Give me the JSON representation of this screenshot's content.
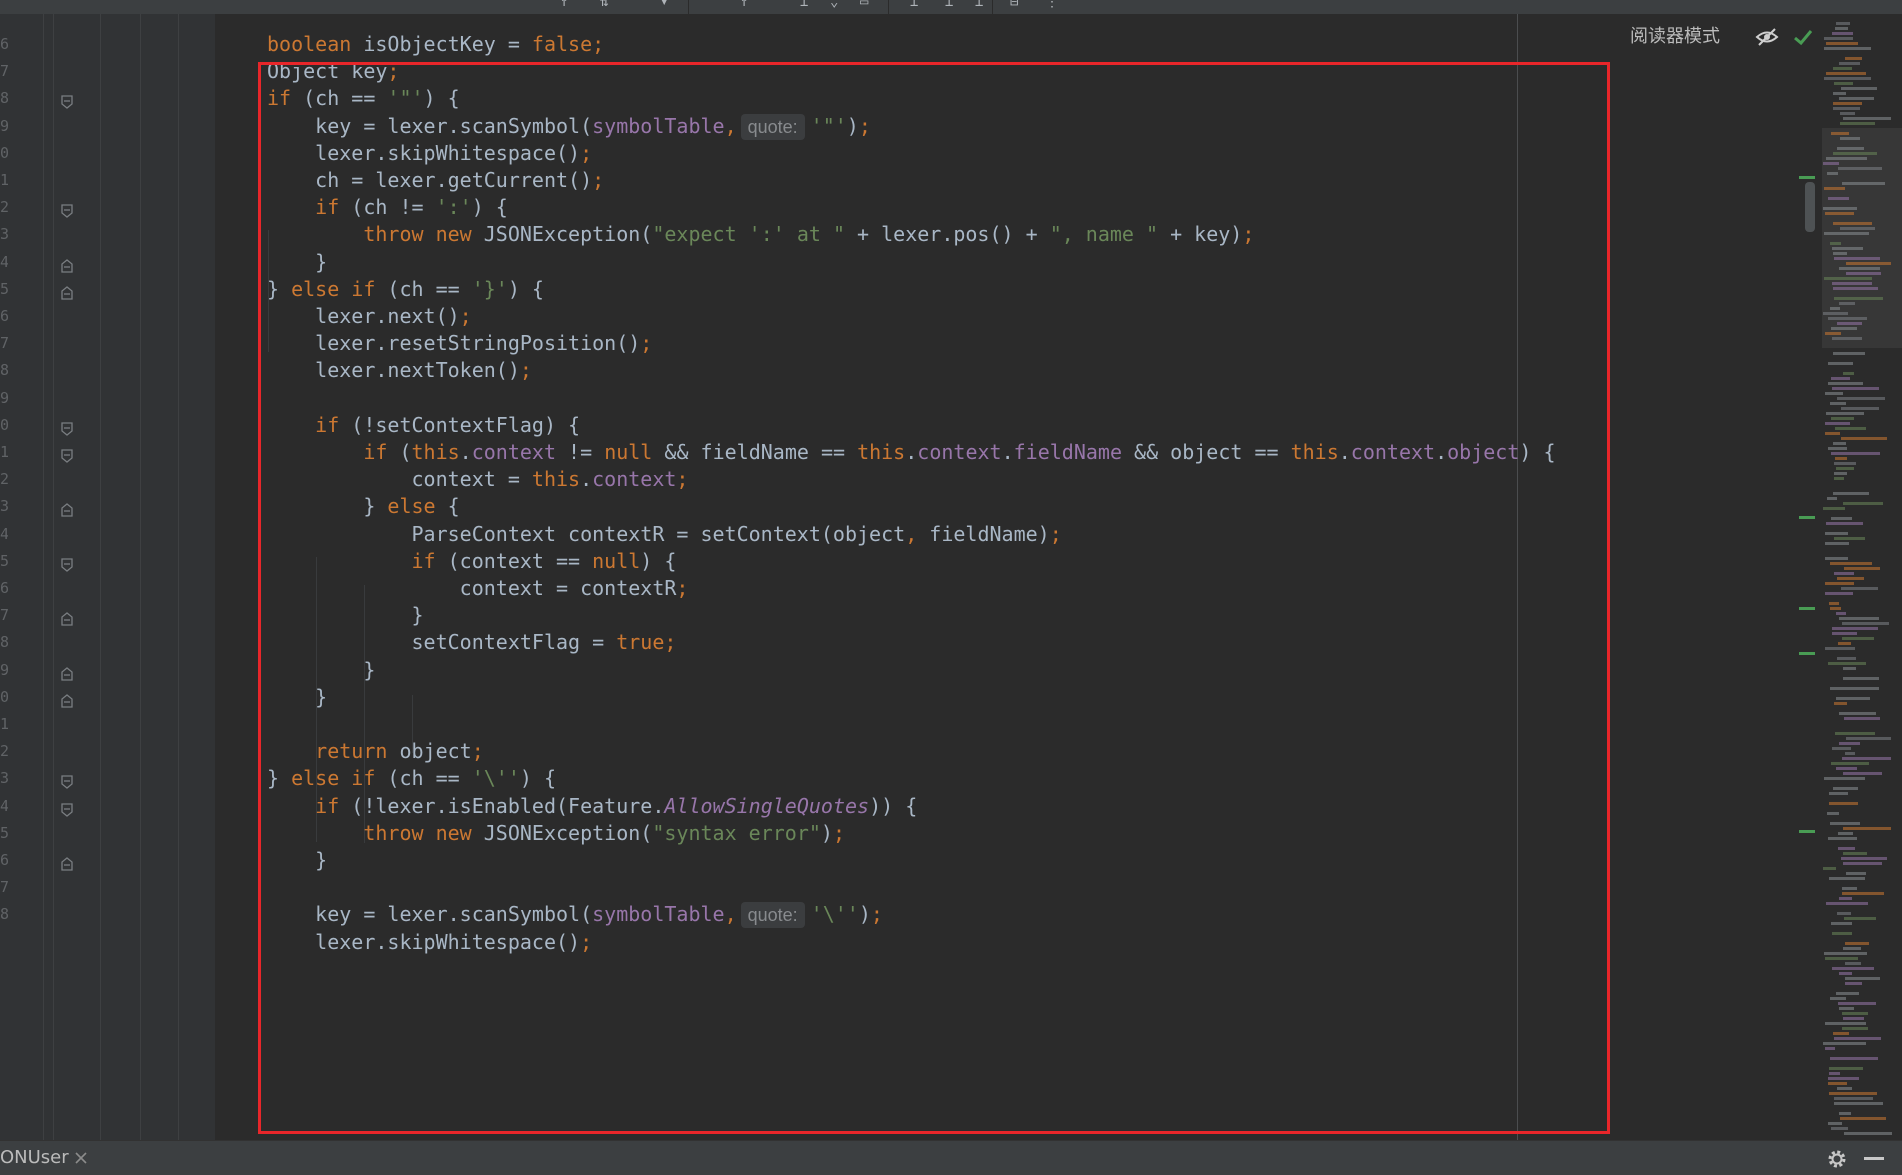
{
  "editor": {
    "reader_mode_label": "阅读器模式",
    "line_numbers": [
      "6",
      "7",
      "8",
      "9",
      "0",
      "1",
      "2",
      "3",
      "4",
      "5",
      "6",
      "7",
      "8",
      "9",
      "0",
      "1",
      "2",
      "3",
      "4",
      "5",
      "6",
      "7",
      "8",
      "9",
      "0",
      "1",
      "2",
      "3",
      "4",
      "5",
      "6",
      "7",
      "8"
    ],
    "code_lines": [
      [
        [
          "boolean ",
          "kw"
        ],
        [
          "isObjectKey = ",
          ""
        ],
        [
          "false",
          "kw"
        ],
        [
          ";",
          "kw"
        ]
      ],
      [
        [
          "Object key",
          ""
        ],
        [
          ";",
          "kw"
        ]
      ],
      [
        [
          "if ",
          "kw"
        ],
        [
          "(ch == ",
          ""
        ],
        [
          "'\"'",
          "str"
        ],
        [
          ") {",
          ""
        ]
      ],
      [
        [
          "    key = lexer.scanSymbol(",
          ""
        ],
        [
          "symbolTable",
          "field"
        ],
        [
          ",",
          "kw"
        ],
        [
          "quote:",
          "hint"
        ],
        [
          "'\"'",
          "str"
        ],
        [
          ")",
          ""
        ],
        [
          ";",
          "kw"
        ]
      ],
      [
        [
          "    lexer.skipWhitespace()",
          ""
        ],
        [
          ";",
          "kw"
        ]
      ],
      [
        [
          "    ch = lexer.getCurrent()",
          ""
        ],
        [
          ";",
          "kw"
        ]
      ],
      [
        [
          "    ",
          ""
        ],
        [
          "if ",
          "kw"
        ],
        [
          "(ch != ",
          ""
        ],
        [
          "':'",
          "str"
        ],
        [
          ") {",
          ""
        ]
      ],
      [
        [
          "        ",
          ""
        ],
        [
          "throw new ",
          "kw"
        ],
        [
          "JSONException(",
          ""
        ],
        [
          "\"expect ':' at \"",
          "str"
        ],
        [
          " + lexer.pos() + ",
          ""
        ],
        [
          "\", name \"",
          "str"
        ],
        [
          " + key)",
          ""
        ],
        [
          ";",
          "kw"
        ]
      ],
      [
        [
          "    }",
          ""
        ]
      ],
      [
        [
          "} ",
          ""
        ],
        [
          "else if ",
          "kw"
        ],
        [
          "(ch == ",
          ""
        ],
        [
          "'}'",
          "str"
        ],
        [
          ") {",
          ""
        ]
      ],
      [
        [
          "    lexer.next()",
          ""
        ],
        [
          ";",
          "kw"
        ]
      ],
      [
        [
          "    lexer.resetStringPosition()",
          ""
        ],
        [
          ";",
          "kw"
        ]
      ],
      [
        [
          "    lexer.nextToken()",
          ""
        ],
        [
          ";",
          "kw"
        ]
      ],
      [
        [
          "",
          ""
        ]
      ],
      [
        [
          "    ",
          ""
        ],
        [
          "if ",
          "kw"
        ],
        [
          "(!setContextFlag) {",
          ""
        ]
      ],
      [
        [
          "        ",
          ""
        ],
        [
          "if ",
          "kw"
        ],
        [
          "(",
          ""
        ],
        [
          "this",
          "kw"
        ],
        [
          ".",
          ""
        ],
        [
          "context",
          "field"
        ],
        [
          " != ",
          ""
        ],
        [
          "null ",
          "kw"
        ],
        [
          "&& fieldName == ",
          ""
        ],
        [
          "this",
          "kw"
        ],
        [
          ".",
          ""
        ],
        [
          "context",
          "field"
        ],
        [
          ".",
          ""
        ],
        [
          "fieldName",
          "field"
        ],
        [
          " && object == ",
          ""
        ],
        [
          "this",
          "kw"
        ],
        [
          ".",
          ""
        ],
        [
          "context",
          "field"
        ],
        [
          ".",
          ""
        ],
        [
          "object",
          "field"
        ],
        [
          ") {",
          ""
        ]
      ],
      [
        [
          "            context = ",
          ""
        ],
        [
          "this",
          "kw"
        ],
        [
          ".",
          ""
        ],
        [
          "context",
          "field"
        ],
        [
          ";",
          "kw"
        ]
      ],
      [
        [
          "        } ",
          ""
        ],
        [
          "else ",
          "kw"
        ],
        [
          "{",
          ""
        ]
      ],
      [
        [
          "            ParseContext contextR = setContext(object",
          ""
        ],
        [
          ",",
          "kw"
        ],
        [
          " fieldName)",
          ""
        ],
        [
          ";",
          "kw"
        ]
      ],
      [
        [
          "            ",
          ""
        ],
        [
          "if ",
          "kw"
        ],
        [
          "(context == ",
          ""
        ],
        [
          "null",
          "kw"
        ],
        [
          ") {",
          ""
        ]
      ],
      [
        [
          "                context = contextR",
          ""
        ],
        [
          ";",
          "kw"
        ]
      ],
      [
        [
          "            }",
          ""
        ]
      ],
      [
        [
          "            setContextFlag = ",
          ""
        ],
        [
          "true",
          "kw"
        ],
        [
          ";",
          "kw"
        ]
      ],
      [
        [
          "        }",
          ""
        ]
      ],
      [
        [
          "    }",
          ""
        ]
      ],
      [
        [
          "",
          ""
        ]
      ],
      [
        [
          "    ",
          ""
        ],
        [
          "return ",
          "kw"
        ],
        [
          "object",
          ""
        ],
        [
          ";",
          "kw"
        ]
      ],
      [
        [
          "} ",
          ""
        ],
        [
          "else if ",
          "kw"
        ],
        [
          "(ch == ",
          ""
        ],
        [
          "'\\''",
          "str"
        ],
        [
          ") {",
          ""
        ]
      ],
      [
        [
          "    ",
          ""
        ],
        [
          "if ",
          "kw"
        ],
        [
          "(!lexer.isEnabled(Feature.",
          ""
        ],
        [
          "AllowSingleQuotes",
          "ital"
        ],
        [
          ")) {",
          ""
        ]
      ],
      [
        [
          "        ",
          ""
        ],
        [
          "throw new ",
          "kw"
        ],
        [
          "JSONException(",
          ""
        ],
        [
          "\"syntax error\"",
          "str"
        ],
        [
          ")",
          ""
        ],
        [
          ";",
          "kw"
        ]
      ],
      [
        [
          "    }",
          ""
        ]
      ],
      [
        [
          "",
          ""
        ]
      ],
      [
        [
          "    key = lexer.scanSymbol(",
          ""
        ],
        [
          "symbolTable",
          "field"
        ],
        [
          ",",
          "kw"
        ],
        [
          "quote:",
          "hint"
        ],
        [
          "'\\''",
          "str"
        ],
        [
          ")",
          ""
        ],
        [
          ";",
          "kw"
        ]
      ],
      [
        [
          "    lexer.skipWhitespace()",
          ""
        ],
        [
          ";",
          "kw"
        ]
      ]
    ]
  },
  "bottom_bar": {
    "file_tab_label": "ONUser"
  },
  "colors": {
    "background": "#2b2b2b",
    "keyword": "#cc7832",
    "string": "#6a8759",
    "field": "#9876aa",
    "plain": "#a9b7c6",
    "highlight_box": "#e8262a",
    "vcs_change": "#499c54"
  },
  "icons": {
    "reader_eye": "eye-crossed-icon",
    "inspection_ok": "check-icon",
    "fold": "fold-marker-icon",
    "tab_close": "close-icon",
    "settings": "gear-icon",
    "hide_panel": "minimize-icon"
  }
}
